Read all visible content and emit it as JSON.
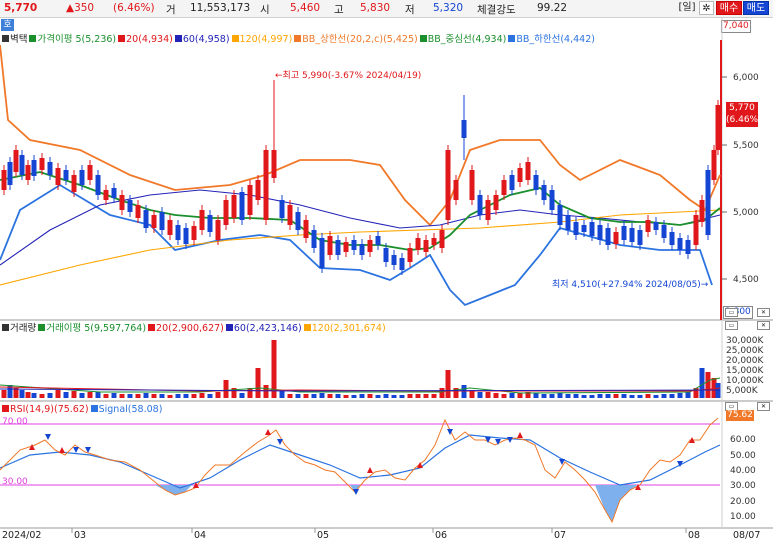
{
  "header": {
    "price": "5,770",
    "change": "▲350",
    "change_pct": "(6.46%)",
    "volume_label": "거",
    "volume": "11,553,173",
    "open_label": "시",
    "open": "5,460",
    "high_label": "고",
    "high": "5,830",
    "low_label": "저",
    "low": "5,320",
    "strength_label": "체결강도",
    "strength": "99.22",
    "period_btn": "[일]",
    "settings_icon": "gear-icon",
    "buy_btn": "매수",
    "sell_btn": "매도"
  },
  "price_panel": {
    "ho_tag": "호",
    "legend": [
      {
        "label": "벽택",
        "color": "#333333"
      },
      {
        "label": "가격이평 5(5,236)",
        "color": "#1a8f2c"
      },
      {
        "label": "20(4,934)",
        "color": "#e0171b"
      },
      {
        "label": "60(4,958)",
        "color": "#2323b8"
      },
      {
        "label": "120(4,997)",
        "color": "#ffa500"
      },
      {
        "label": "BB_상한선(20,2,c)(5,425)",
        "color": "#f07828"
      },
      {
        "label": "BB_중심선(4,934)",
        "color": "#1a8f2c"
      },
      {
        "label": "BB_하한선(4,442)",
        "color": "#2b73e0"
      }
    ],
    "top_box": "7,040",
    "bottom_box": "3,800",
    "current_box": "5,770",
    "current_box_pct": "(6.46%)",
    "scale": [
      "6,000",
      "5,500",
      "5,000",
      "4,500"
    ],
    "high_annotation": "←최고 5,990(-3.67% 2024/04/19)",
    "low_annotation": "최저 4,510(+27.94% 2024/08/05)→"
  },
  "volume_panel": {
    "legend": [
      {
        "label": "거래량",
        "color": "#333333"
      },
      {
        "label": "거래이평 5(9,597,764)",
        "color": "#1a8f2c"
      },
      {
        "label": "20(2,900,627)",
        "color": "#e0171b"
      },
      {
        "label": "60(2,423,146)",
        "color": "#2323b8"
      },
      {
        "label": "120(2,301,674)",
        "color": "#ffa500"
      }
    ],
    "scale": [
      "30,000K",
      "25,000K",
      "20,000K",
      "15,000K",
      "10,000K",
      "5,000K"
    ]
  },
  "rsi_panel": {
    "legend": [
      {
        "label": "RSI(14,9)(75.62)",
        "color": "#e0171b"
      },
      {
        "label": "Signal(58.08)",
        "color": "#2b73e0"
      }
    ],
    "upper_line_label": "70.00",
    "lower_line_label": "30.00",
    "current_box": "75.62",
    "scale": [
      "70.00",
      "60.00",
      "50.00",
      "40.00",
      "30.00",
      "20.00",
      "10.00"
    ]
  },
  "x_axis": {
    "labels": [
      "2024/02",
      "03",
      "04",
      "05",
      "06",
      "07",
      "08"
    ],
    "right_label": "08/07"
  },
  "colors": {
    "up": "#e0171b",
    "down": "#1546d3",
    "bb_upper": "#f07828",
    "bb_mid": "#1a8f2c",
    "bb_lower": "#2b73e0"
  }
}
